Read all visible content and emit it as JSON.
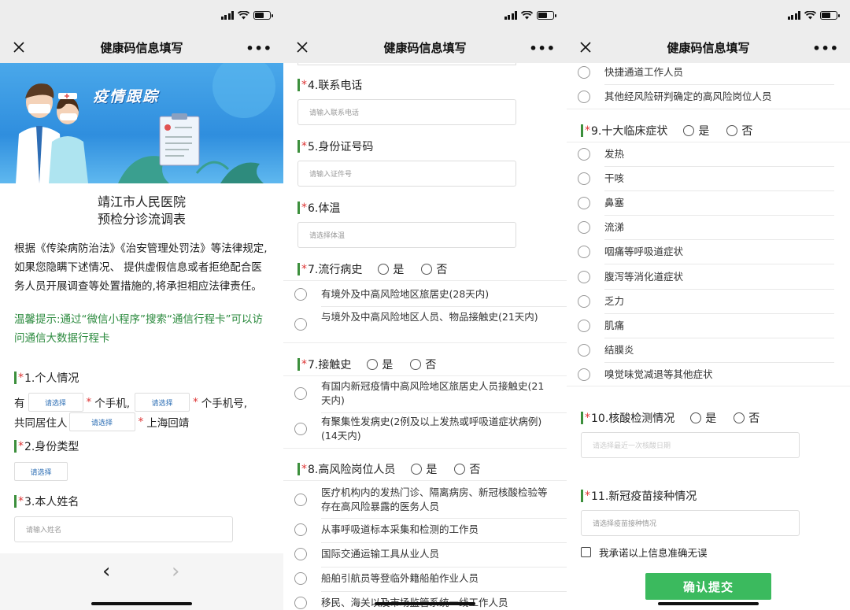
{
  "nav": {
    "title": "健康码信息填写"
  },
  "screen1": {
    "banner_title": "疫情跟踪",
    "hospital": "靖江市人民医院",
    "form_title": "预检分诊流调表",
    "intro": "根据《传染病防治法》《治安管理处罚法》等法律规定,如果您隐瞒下述情况、 提供虚假信息或者拒绝配合医务人员开展调查等处置措施的,将承担相应法律责任。",
    "tip": "温馨提示:通过“微信小程序”搜索“通信行程卡”可以访问通信大数据行程卡",
    "q1": {
      "label": "1.个人情况",
      "line1_prefix": "有",
      "select": "请选择",
      "phone_unit": "个手机,",
      "phone_no_unit": "个手机号,",
      "line2_prefix": "共同居住人",
      "shanghai": "上海回靖"
    },
    "q2": {
      "label": "2.身份类型",
      "select": "请选择"
    },
    "q3": {
      "label": "3.本人姓名",
      "placeholder": "请输入姓名"
    },
    "back": "‹",
    "forward": "›"
  },
  "screen2": {
    "q4": {
      "label": "4.联系电话",
      "placeholder": "请输入联系电话"
    },
    "q5": {
      "label": "5.身份证号码",
      "placeholder": "请输入证件号"
    },
    "q6": {
      "label": "6.体温",
      "placeholder": "请选择体温"
    },
    "q7a": {
      "label": "7.流行病史",
      "yes": "是",
      "no": "否",
      "options": [
        "有境外及中高风险地区旅居史(28天内)",
        "与境外及中高风险地区人员、物品接触史(21天内)"
      ]
    },
    "q7b": {
      "label": "7.接触史",
      "yes": "是",
      "no": "否",
      "options": [
        "有国内新冠疫情中高风险地区旅居史人员接触史(21天内)",
        "有聚集性发病史(2例及以上发热或呼吸道症状病例)(14天内)"
      ]
    },
    "q8": {
      "label": "8.高风险岗位人员",
      "yes": "是",
      "no": "否",
      "options": [
        "医疗机构内的发热门诊、隔离病房、新冠核酸检验等存在高风险暴露的医务人员",
        "从事呼吸道标本采集和检测的工作员",
        "国际交通运输工具从业人员",
        "船舶引航员等登临外籍船舶作业人员",
        "移民、海关以及市场监管系统一线工作人员"
      ]
    }
  },
  "screen3": {
    "top_options": [
      "快捷通道工作人员",
      "其他经风险研判确定的高风险岗位人员"
    ],
    "q9": {
      "label": "9.十大临床症状",
      "yes": "是",
      "no": "否",
      "options": [
        "发热",
        "干咳",
        "鼻塞",
        "流涕",
        "咽痛等呼吸道症状",
        "腹泻等消化道症状",
        "乏力",
        "肌痛",
        "结膜炎",
        "嗅觉味觉减退等其他症状"
      ]
    },
    "q10": {
      "label": "10.核酸检测情况",
      "yes": "是",
      "no": "否",
      "placeholder": "请选择最近一次核酸日期"
    },
    "q11": {
      "label": "11.新冠疫苗接种情况",
      "placeholder": "请选择疫苗接种情况"
    },
    "agree": "我承诺以上信息准确无误",
    "submit": "确认提交"
  }
}
